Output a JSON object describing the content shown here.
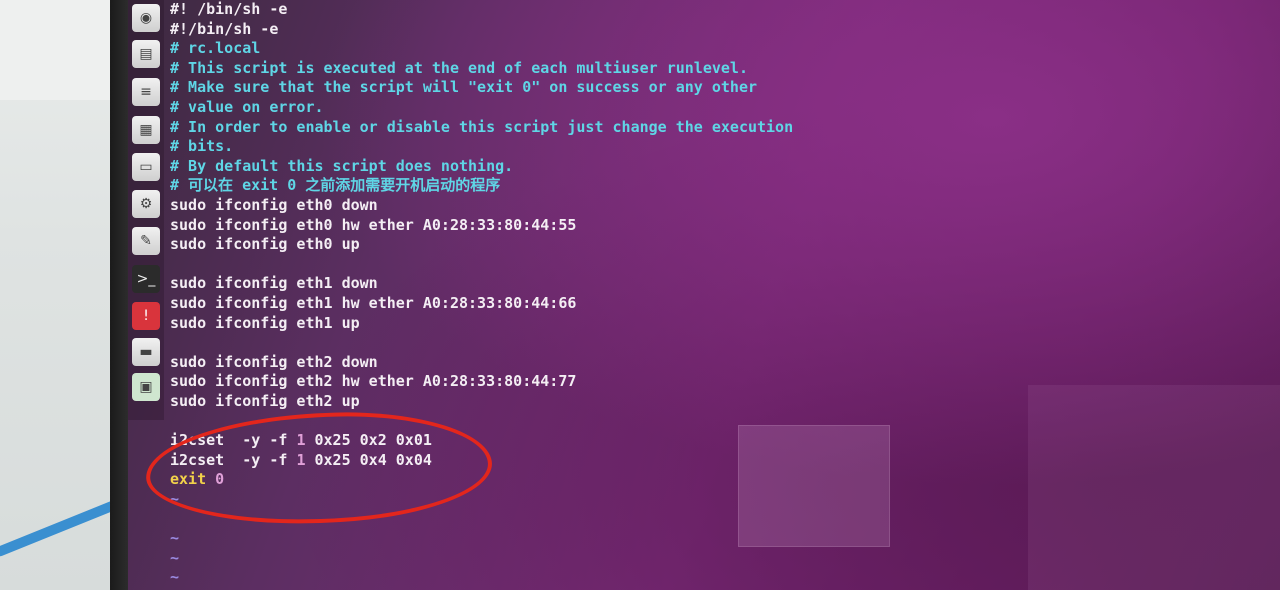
{
  "terminal": {
    "header_lines": [
      "#! /bin/sh -e",
      "#!/bin/sh -e"
    ],
    "comments": [
      "# rc.local",
      "# This script is executed at the end of each multiuser runlevel.",
      "# Make sure that the script will \"exit 0\" on success or any other",
      "# value on error.",
      "# In order to enable or disable this script just change the execution",
      "# bits.",
      "# By default this script does nothing.",
      "# 可以在 exit 0 之前添加需要开机启动的程序"
    ],
    "eth0": [
      "sudo ifconfig eth0 down",
      "sudo ifconfig eth0 hw ether A0:28:33:80:44:55",
      "sudo ifconfig eth0 up"
    ],
    "eth1": [
      "sudo ifconfig eth1 down",
      "sudo ifconfig eth1 hw ether A0:28:33:80:44:66",
      "sudo ifconfig eth1 up"
    ],
    "eth2": [
      "sudo ifconfig eth2 down",
      "sudo ifconfig eth2 hw ether A0:28:33:80:44:77",
      "sudo ifconfig eth2 up"
    ],
    "i2c": [
      {
        "cmd": "i2cset  -y -f ",
        "bus": "1",
        "rest": " 0x25 0x2 0x01"
      },
      {
        "cmd": "i2cset  -y -f ",
        "bus": "1",
        "rest": " 0x25 0x4 0x04"
      }
    ],
    "exit_cmd": "exit",
    "exit_code": "0",
    "tilde": "~"
  },
  "launcher": {
    "icons": [
      "ubuntu-dash-icon",
      "files-icon",
      "text-editor-icon",
      "spreadsheet-icon",
      "document-icon",
      "settings-icon",
      "system-tools-icon",
      "terminal-icon",
      "error-icon",
      "drive-icon",
      "image-icon"
    ]
  },
  "colors": {
    "comment": "#5fd6e6",
    "command": "#f4eef4",
    "exit": "#f2d24a",
    "tilde": "#9a8ae0",
    "annotation": "#e3261c"
  }
}
